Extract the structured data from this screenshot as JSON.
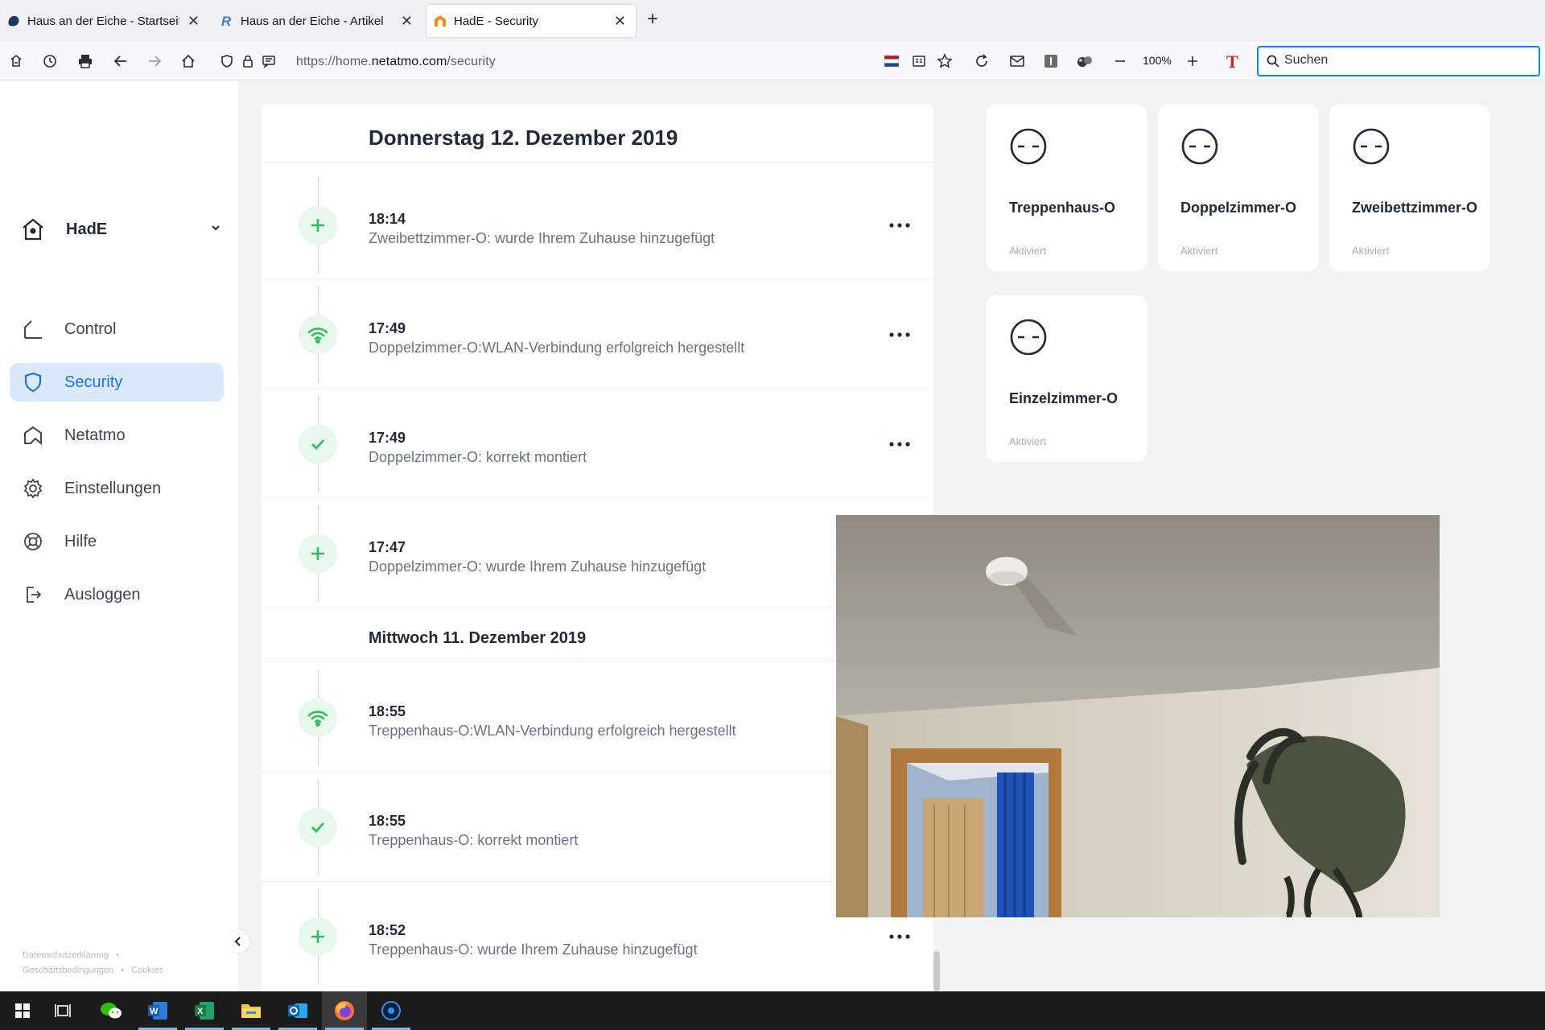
{
  "browser": {
    "tabs": [
      {
        "title": "Haus an der Eiche - Startseite",
        "close": "✕",
        "active": false
      },
      {
        "title": "Haus an der Eiche - Artikel",
        "close": "✕",
        "active": false
      },
      {
        "title": "HadE - Security",
        "close": "✕",
        "active": true
      }
    ],
    "new_tab": "+",
    "url_prefix": "https://home.",
    "url_domain": "netatmo.com",
    "url_path": "/security",
    "zoom": "100%",
    "search_placeholder": "Suchen"
  },
  "sidebar": {
    "home_name": "HadE",
    "nav": [
      {
        "label": "Control",
        "icon": "home-outline-icon",
        "active": false
      },
      {
        "label": "Security",
        "icon": "shield-icon",
        "active": true
      },
      {
        "label": "Netatmo",
        "icon": "netatmo-logo-icon",
        "active": false
      },
      {
        "label": "Einstellungen",
        "icon": "gear-icon",
        "active": false
      },
      {
        "label": "Hilfe",
        "icon": "lifebuoy-icon",
        "active": false
      },
      {
        "label": "Ausloggen",
        "icon": "logout-icon",
        "active": false
      }
    ],
    "legal": {
      "privacy": "Datenschutzerklärung",
      "sep1": "•",
      "terms": "Geschäftsbedingungen",
      "sep2": "•",
      "cookies": "Cookies"
    }
  },
  "timeline": {
    "days": [
      {
        "label": "Donnerstag 12. Dezember 2019",
        "events": [
          {
            "time": "18:14",
            "text": "Zweibettzimmer-O: wurde Ihrem Zuhause hinzugefügt",
            "icon": "plus-icon"
          },
          {
            "time": "17:49",
            "text": "Doppelzimmer-O:WLAN-Verbindung erfolgreich hergestellt",
            "icon": "wifi-icon"
          },
          {
            "time": "17:49",
            "text": "Doppelzimmer-O: korrekt montiert",
            "icon": "check-icon"
          },
          {
            "time": "17:47",
            "text": "Doppelzimmer-O: wurde Ihrem Zuhause hinzugefügt",
            "icon": "plus-icon"
          }
        ]
      },
      {
        "label": "Mittwoch 11. Dezember 2019",
        "events": [
          {
            "time": "18:55",
            "text": "Treppenhaus-O:WLAN-Verbindung erfolgreich hergestellt",
            "icon": "wifi-icon"
          },
          {
            "time": "18:55",
            "text": "Treppenhaus-O: korrekt montiert",
            "icon": "check-icon"
          },
          {
            "time": "18:52",
            "text": "Treppenhaus-O: wurde Ihrem Zuhause hinzugefügt",
            "icon": "plus-icon"
          }
        ]
      }
    ]
  },
  "devices": [
    {
      "name": "Treppenhaus-O",
      "status": "Aktiviert"
    },
    {
      "name": "Doppelzimmer-O",
      "status": "Aktiviert"
    },
    {
      "name": "Zweibettzimmer-O",
      "status": "Aktiviert"
    },
    {
      "name": "Einzelzimmer-O",
      "status": "Aktiviert"
    }
  ],
  "colors": {
    "accent": "#1e6fe0",
    "active_nav_bg": "#dbe9fd",
    "event_icon_green": "#2ebd59",
    "event_icon_bg": "#e8f7ec"
  },
  "taskbar": {
    "apps": [
      "windows-start-icon",
      "task-view-icon",
      "wechat-icon",
      "word-icon",
      "excel-icon",
      "file-explorer-icon",
      "outlook-icon",
      "firefox-icon",
      "app-icon"
    ]
  }
}
